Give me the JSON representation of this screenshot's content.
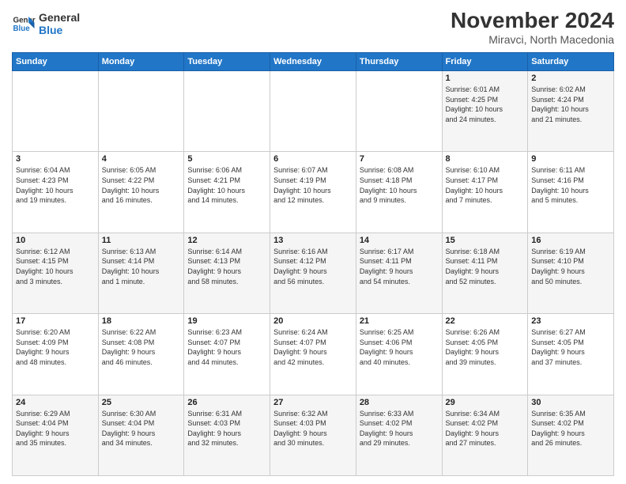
{
  "logo": {
    "line1": "General",
    "line2": "Blue"
  },
  "title": "November 2024",
  "subtitle": "Miravci, North Macedonia",
  "header_days": [
    "Sunday",
    "Monday",
    "Tuesday",
    "Wednesday",
    "Thursday",
    "Friday",
    "Saturday"
  ],
  "weeks": [
    [
      {
        "day": "",
        "info": ""
      },
      {
        "day": "",
        "info": ""
      },
      {
        "day": "",
        "info": ""
      },
      {
        "day": "",
        "info": ""
      },
      {
        "day": "",
        "info": ""
      },
      {
        "day": "1",
        "info": "Sunrise: 6:01 AM\nSunset: 4:25 PM\nDaylight: 10 hours\nand 24 minutes."
      },
      {
        "day": "2",
        "info": "Sunrise: 6:02 AM\nSunset: 4:24 PM\nDaylight: 10 hours\nand 21 minutes."
      }
    ],
    [
      {
        "day": "3",
        "info": "Sunrise: 6:04 AM\nSunset: 4:23 PM\nDaylight: 10 hours\nand 19 minutes."
      },
      {
        "day": "4",
        "info": "Sunrise: 6:05 AM\nSunset: 4:22 PM\nDaylight: 10 hours\nand 16 minutes."
      },
      {
        "day": "5",
        "info": "Sunrise: 6:06 AM\nSunset: 4:21 PM\nDaylight: 10 hours\nand 14 minutes."
      },
      {
        "day": "6",
        "info": "Sunrise: 6:07 AM\nSunset: 4:19 PM\nDaylight: 10 hours\nand 12 minutes."
      },
      {
        "day": "7",
        "info": "Sunrise: 6:08 AM\nSunset: 4:18 PM\nDaylight: 10 hours\nand 9 minutes."
      },
      {
        "day": "8",
        "info": "Sunrise: 6:10 AM\nSunset: 4:17 PM\nDaylight: 10 hours\nand 7 minutes."
      },
      {
        "day": "9",
        "info": "Sunrise: 6:11 AM\nSunset: 4:16 PM\nDaylight: 10 hours\nand 5 minutes."
      }
    ],
    [
      {
        "day": "10",
        "info": "Sunrise: 6:12 AM\nSunset: 4:15 PM\nDaylight: 10 hours\nand 3 minutes."
      },
      {
        "day": "11",
        "info": "Sunrise: 6:13 AM\nSunset: 4:14 PM\nDaylight: 10 hours\nand 1 minute."
      },
      {
        "day": "12",
        "info": "Sunrise: 6:14 AM\nSunset: 4:13 PM\nDaylight: 9 hours\nand 58 minutes."
      },
      {
        "day": "13",
        "info": "Sunrise: 6:16 AM\nSunset: 4:12 PM\nDaylight: 9 hours\nand 56 minutes."
      },
      {
        "day": "14",
        "info": "Sunrise: 6:17 AM\nSunset: 4:11 PM\nDaylight: 9 hours\nand 54 minutes."
      },
      {
        "day": "15",
        "info": "Sunrise: 6:18 AM\nSunset: 4:11 PM\nDaylight: 9 hours\nand 52 minutes."
      },
      {
        "day": "16",
        "info": "Sunrise: 6:19 AM\nSunset: 4:10 PM\nDaylight: 9 hours\nand 50 minutes."
      }
    ],
    [
      {
        "day": "17",
        "info": "Sunrise: 6:20 AM\nSunset: 4:09 PM\nDaylight: 9 hours\nand 48 minutes."
      },
      {
        "day": "18",
        "info": "Sunrise: 6:22 AM\nSunset: 4:08 PM\nDaylight: 9 hours\nand 46 minutes."
      },
      {
        "day": "19",
        "info": "Sunrise: 6:23 AM\nSunset: 4:07 PM\nDaylight: 9 hours\nand 44 minutes."
      },
      {
        "day": "20",
        "info": "Sunrise: 6:24 AM\nSunset: 4:07 PM\nDaylight: 9 hours\nand 42 minutes."
      },
      {
        "day": "21",
        "info": "Sunrise: 6:25 AM\nSunset: 4:06 PM\nDaylight: 9 hours\nand 40 minutes."
      },
      {
        "day": "22",
        "info": "Sunrise: 6:26 AM\nSunset: 4:05 PM\nDaylight: 9 hours\nand 39 minutes."
      },
      {
        "day": "23",
        "info": "Sunrise: 6:27 AM\nSunset: 4:05 PM\nDaylight: 9 hours\nand 37 minutes."
      }
    ],
    [
      {
        "day": "24",
        "info": "Sunrise: 6:29 AM\nSunset: 4:04 PM\nDaylight: 9 hours\nand 35 minutes."
      },
      {
        "day": "25",
        "info": "Sunrise: 6:30 AM\nSunset: 4:04 PM\nDaylight: 9 hours\nand 34 minutes."
      },
      {
        "day": "26",
        "info": "Sunrise: 6:31 AM\nSunset: 4:03 PM\nDaylight: 9 hours\nand 32 minutes."
      },
      {
        "day": "27",
        "info": "Sunrise: 6:32 AM\nSunset: 4:03 PM\nDaylight: 9 hours\nand 30 minutes."
      },
      {
        "day": "28",
        "info": "Sunrise: 6:33 AM\nSunset: 4:02 PM\nDaylight: 9 hours\nand 29 minutes."
      },
      {
        "day": "29",
        "info": "Sunrise: 6:34 AM\nSunset: 4:02 PM\nDaylight: 9 hours\nand 27 minutes."
      },
      {
        "day": "30",
        "info": "Sunrise: 6:35 AM\nSunset: 4:02 PM\nDaylight: 9 hours\nand 26 minutes."
      }
    ]
  ]
}
